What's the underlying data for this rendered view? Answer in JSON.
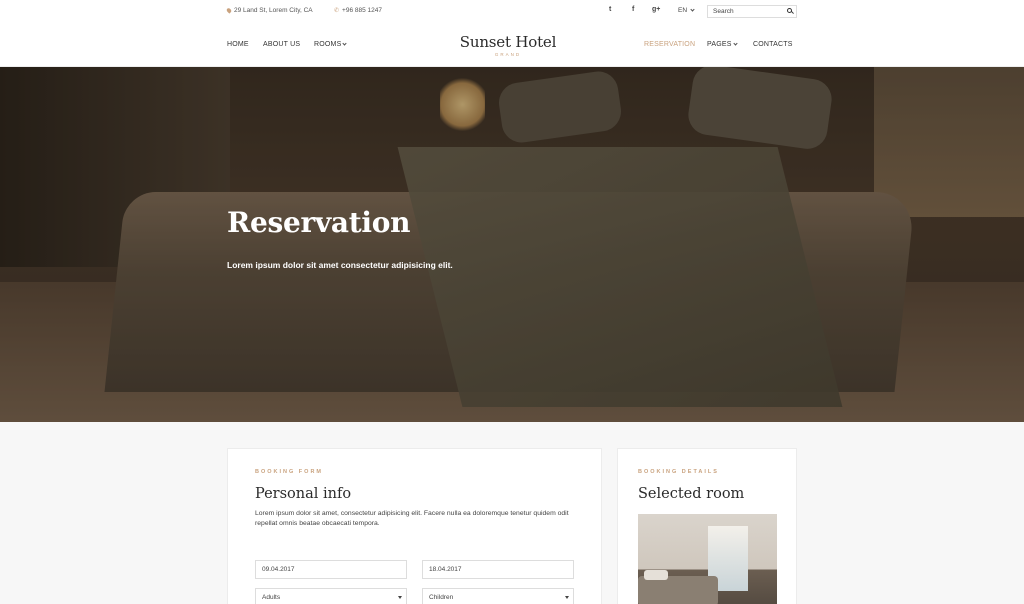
{
  "topbar": {
    "address": "29 Land St, Lorem City, CA",
    "phone": "+96 885 1247",
    "social": [
      "twitter-icon",
      "facebook-icon",
      "google-plus-icon"
    ],
    "social_glyphs": [
      "t",
      "f",
      "g+"
    ],
    "language": "EN",
    "search_placeholder": "Search"
  },
  "nav": {
    "left": [
      "HOME",
      "ABOUT US",
      "ROOMS"
    ],
    "right": [
      "RESERVATION",
      "PAGES",
      "CONTACTS"
    ],
    "active": "RESERVATION",
    "logo": "Sunset Hotel",
    "logo_sub": "GRAND"
  },
  "hero": {
    "title": "Reservation",
    "subtitle": "Lorem ipsum dolor sit amet consectetur adipisicing elit."
  },
  "booking_form": {
    "eyebrow": "BOOKING FORM",
    "title": "Personal info",
    "description": "Lorem ipsum dolor sit amet, consectetur adipisicing elit. Facere nulla ea doloremque tenetur quidem odit repellat omnis beatae obcaecati tempora.",
    "checkin": "09.04.2017",
    "checkout": "18.04.2017",
    "adults_label": "Adults",
    "children_label": "Children"
  },
  "booking_details": {
    "eyebrow": "BOOKING DETAILS",
    "title": "Selected room"
  },
  "colors": {
    "accent": "#c9a27e",
    "text": "#333333",
    "background": "#f7f7f7"
  }
}
